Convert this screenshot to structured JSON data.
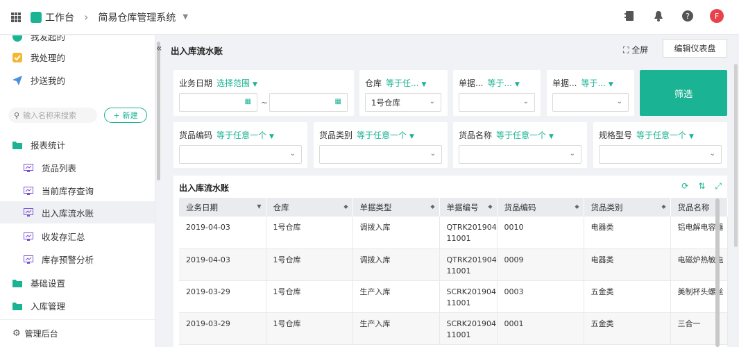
{
  "topbar": {
    "workbench": "工作台",
    "app_name": "简易仓库管理系统",
    "avatar_letter": "F"
  },
  "sidebar": {
    "items_top": [
      {
        "label": "我发起的"
      },
      {
        "label": "我处理的"
      },
      {
        "label": "抄送我的"
      }
    ],
    "search_placeholder": "输入名称来搜索",
    "new_button": "新建",
    "groups": [
      {
        "label": "报表统计"
      },
      {
        "label": "基础设置"
      },
      {
        "label": "入库管理"
      }
    ],
    "reports": [
      {
        "label": "货品列表"
      },
      {
        "label": "当前库存查询"
      },
      {
        "label": "出入库流水账"
      },
      {
        "label": "收发存汇总"
      },
      {
        "label": "库存预警分析"
      }
    ],
    "admin": "管理后台"
  },
  "page": {
    "title": "出入库流水账",
    "fullscreen": "全屏",
    "edit_dashboard": "编辑仪表盘"
  },
  "filters": {
    "date_label": "业务日期",
    "date_op": "选择范围",
    "tilde": "~",
    "warehouse_label": "仓库",
    "warehouse_op": "等于任...",
    "warehouse_value": "1号仓库",
    "billno_label": "单据...",
    "billno_op": "等于...",
    "billtype_label": "单据...",
    "billtype_op": "等于...",
    "filter_button": "筛选",
    "code_label": "货品编码",
    "code_op": "等于任意一个",
    "category_label": "货品类别",
    "category_op": "等于任意一个",
    "name_label": "货品名称",
    "name_op": "等于任意一个",
    "spec_label": "规格型号",
    "spec_op": "等于任意一个"
  },
  "table": {
    "title": "出入库流水账",
    "columns": [
      "业务日期",
      "仓库",
      "单据类型",
      "单据编号",
      "货品编码",
      "货品类别",
      "货品名称"
    ],
    "rows": [
      {
        "date": "2019-04-03",
        "warehouse": "1号仓库",
        "type": "调拨入库",
        "no1": "QTRK201904",
        "no2": "11001",
        "code": "0010",
        "category": "电器类",
        "name": "铝电解电容器"
      },
      {
        "date": "2019-04-03",
        "warehouse": "1号仓库",
        "type": "调拨入库",
        "no1": "QTRK201904",
        "no2": "11001",
        "code": "0009",
        "category": "电器类",
        "name": "电磁炉热敏电"
      },
      {
        "date": "2019-03-29",
        "warehouse": "1号仓库",
        "type": "生产入库",
        "no1": "SCRK201904",
        "no2": "11001",
        "code": "0003",
        "category": "五金类",
        "name": "美制杯头螺丝"
      },
      {
        "date": "2019-03-29",
        "warehouse": "1号仓库",
        "type": "生产入库",
        "no1": "SCRK201904",
        "no2": "11001",
        "code": "0001",
        "category": "五金类",
        "name": "三合一"
      }
    ]
  },
  "colors": {
    "accent": "#1ab394",
    "avatar": "#e8424b"
  }
}
